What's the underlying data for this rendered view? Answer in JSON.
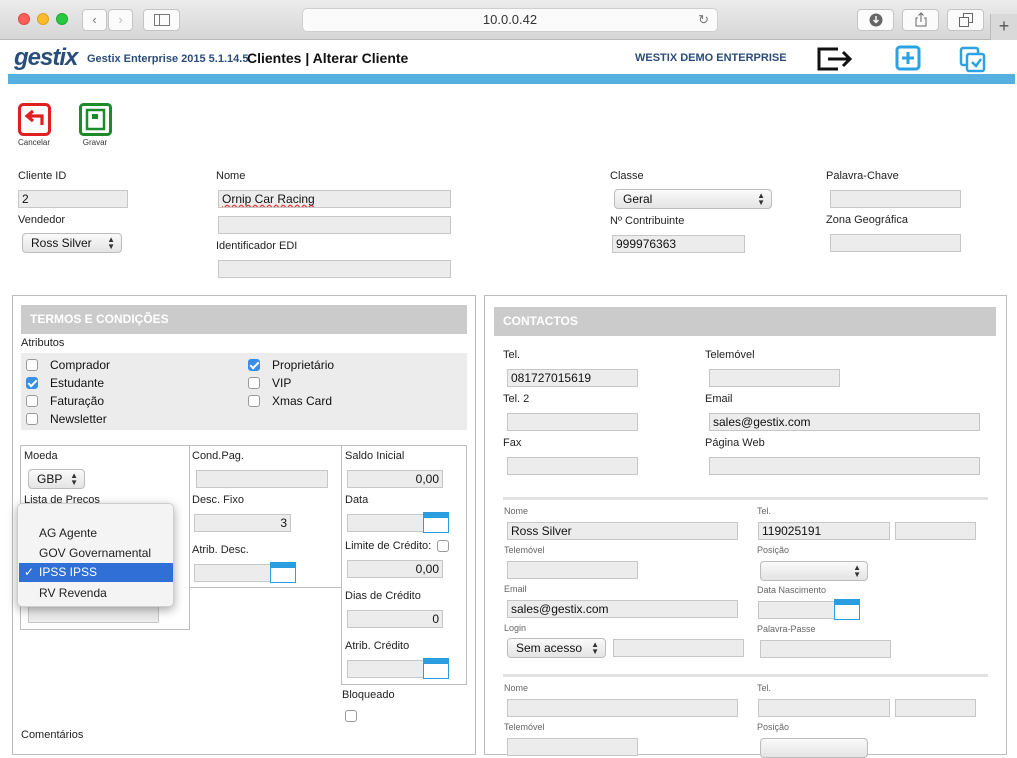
{
  "browser": {
    "address": "10.0.0.42"
  },
  "app": {
    "logo": "gestix",
    "version": "Gestix Enterprise 2015 5.1.14.5",
    "title": "Clientes | Alterar Cliente",
    "company": "WESTIX DEMO ENTERPRISE"
  },
  "toolbar": {
    "cancel": "Cancelar",
    "save": "Gravar"
  },
  "top": {
    "cliente_id_label": "Cliente ID",
    "cliente_id": "2",
    "vendedor_label": "Vendedor",
    "vendedor": "Ross Silver",
    "nome_label": "Nome",
    "nome": "Ornip Car Racing",
    "nome2": "",
    "edi_label": "Identificador EDI",
    "edi": "",
    "classe_label": "Classe",
    "classe": "Geral",
    "contribuinte_label": "Nº Contribuinte",
    "contribuinte": "999976363",
    "palavra_label": "Palavra-Chave",
    "palavra": "",
    "zona_label": "Zona Geográfica",
    "zona": ""
  },
  "termos": {
    "header": "TERMOS E CONDIÇÕES",
    "atributos_label": "Atributos",
    "attrs": [
      {
        "label": "Comprador",
        "checked": false
      },
      {
        "label": "Estudante",
        "checked": true
      },
      {
        "label": "Faturação",
        "checked": false
      },
      {
        "label": "Newsletter",
        "checked": false
      },
      {
        "label": "Proprietário",
        "checked": true
      },
      {
        "label": "VIP",
        "checked": false
      },
      {
        "label": "Xmas Card",
        "checked": false
      }
    ],
    "moeda_label": "Moeda",
    "moeda": "GBP",
    "lista_label": "Lista de Preços",
    "condpag_label": "Cond.Pag.",
    "descfixo_label": "Desc. Fixo",
    "descfixo": "3",
    "atribdesc_label": "Atrib. Desc.",
    "saldo_label": "Saldo Inicial",
    "saldo": "0,00",
    "data_label": "Data",
    "limite_label": "Limite de Crédito:",
    "limite": "0,00",
    "dias_label": "Dias de Crédito",
    "dias": "0",
    "atribcred_label": "Atrib. Crédito",
    "bloqueado_label": "Bloqueado",
    "comentarios_label": "Comentários"
  },
  "popup": {
    "options": [
      {
        "label": "AG Agente",
        "selected": false
      },
      {
        "label": "GOV Governamental",
        "selected": false
      },
      {
        "label": "IPSS IPSS",
        "selected": true
      },
      {
        "label": "RV Revenda",
        "selected": false
      }
    ],
    "check": "✓"
  },
  "contactos": {
    "header": "CONTACTOS",
    "tel_label": "Tel.",
    "tel": "081727015619",
    "telemovel_label": "Telemóvel",
    "telemovel": "",
    "tel2_label": "Tel. 2",
    "tel2": "",
    "email_label": "Email",
    "email": "sales@gestix.com",
    "fax_label": "Fax",
    "fax": "",
    "web_label": "Página Web",
    "web": "",
    "p1": {
      "nome_label": "Nome",
      "nome": "Ross Silver",
      "tel_label": "Tel.",
      "tel": "119025191",
      "telemovel_label": "Telemóvel",
      "posicao_label": "Posição",
      "email_label": "Email",
      "email": "sales@gestix.com",
      "nasc_label": "Data Nascimento",
      "login_label": "Login",
      "login": "Sem acesso",
      "passe_label": "Palavra-Passe"
    },
    "p2": {
      "nome_label": "Nome",
      "tel_label": "Tel.",
      "telemovel_label": "Telemóvel",
      "posicao_label": "Posição"
    }
  },
  "colors": {
    "accent": "#55b0e0",
    "brand": "#2a4d7c",
    "cancel": "#e02020",
    "save": "#1e8a2a",
    "check": "#3b8ee8",
    "selection": "#2f6fd6"
  }
}
